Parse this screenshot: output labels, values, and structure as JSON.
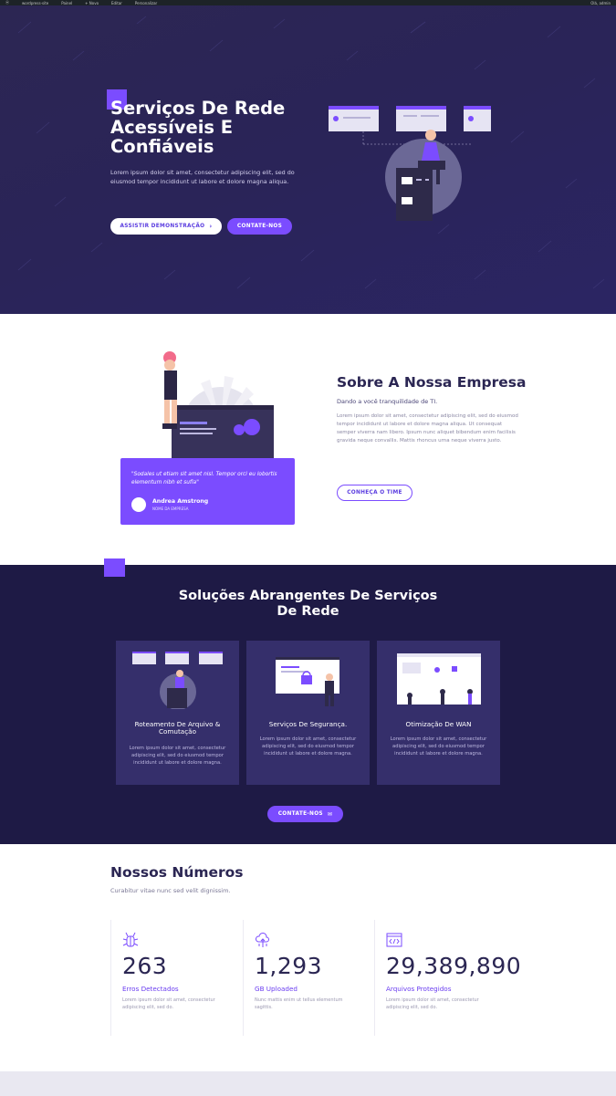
{
  "adminbar": {
    "items": [
      "ⓦ",
      "wordpress-site",
      "Painel",
      "+ Novo",
      "Editar",
      "Personalizar"
    ],
    "right": "Olá, admin"
  },
  "hero": {
    "title": "Serviços De Rede Acessíveis E Confiáveis",
    "lead": "Lorem ipsum dolor sit amet, consectetur adipiscing elit, sed do eiusmod tempor incididunt ut labore et dolore magna aliqua.",
    "demo_button": "ASSISTIR DEMONSTRAÇÃO",
    "demo_arrow": "›",
    "contact_button": "CONTATE-NOS"
  },
  "about": {
    "title": "Sobre A Nossa Empresa",
    "subtitle": "Dando a você tranquilidade de TI.",
    "body": "Lorem ipsum dolor sit amet, consectetur adipiscing elit, sed do eiusmod tempor incididunt ut labore et dolore magna aliqua. Ut consequat semper viverra nam libero. Ipsum nunc aliquet bibendum enim facilisis gravida neque convallis. Mattis rhoncus urna neque viverra justo.",
    "team_button": "CONHEÇA O TIME",
    "quote": {
      "text": "\"Sodales ut etiam sit amet nisl. Tempor orci eu lobortis elementum nibh et sufla\"",
      "name": "Andrea Amstrong",
      "role": "NOME DA EMPRESA"
    }
  },
  "solutions": {
    "title": "Soluções Abrangentes De Serviços De Rede",
    "cards": [
      {
        "title": "Roteamento De Arquivo & Comutação",
        "body": "Lorem ipsum dolor sit amet, consectetur adipiscing elit, sed do eiusmod tempor incididunt ut labore et dolore magna."
      },
      {
        "title": "Serviços De Segurança.",
        "body": "Lorem ipsum dolor sit amet, consectetur adipiscing elit, sed do eiusmod tempor incididunt ut labore et dolore magna."
      },
      {
        "title": "Otimização De WAN",
        "body": "Lorem ipsum dolor sit amet, consectetur adipiscing elit, sed do eiusmod tempor incididunt ut labore et dolore magna."
      }
    ],
    "contact_button": "CONTATE-NOS",
    "contact_icon": "✉"
  },
  "numbers": {
    "title": "Nossos Números",
    "subtitle": "Curabitur vitae nunc sed velit dignissim.",
    "stats": [
      {
        "icon": "bug-icon",
        "value": "263",
        "label": "Erros Detectados",
        "body": "Lorem ipsum dolor sit amet, consectetur adipiscing elit, sed do."
      },
      {
        "icon": "cloud-upload-icon",
        "value": "1,293",
        "label": "GB Uploaded",
        "body": "Nunc mattis enim ut tellus elementum sagittis."
      },
      {
        "icon": "code-icon",
        "value": "29,389,890",
        "label": "Arquivos Protegidos",
        "body": "Lorem ipsum dolor sit amet, consectetur adipiscing elit, sed do."
      }
    ]
  },
  "colors": {
    "accent": "#7b4cff",
    "hero_bg": "#2b2558",
    "dark_section": "#1e1a45",
    "card_bg": "#352f6b",
    "heading": "#2b2653"
  }
}
